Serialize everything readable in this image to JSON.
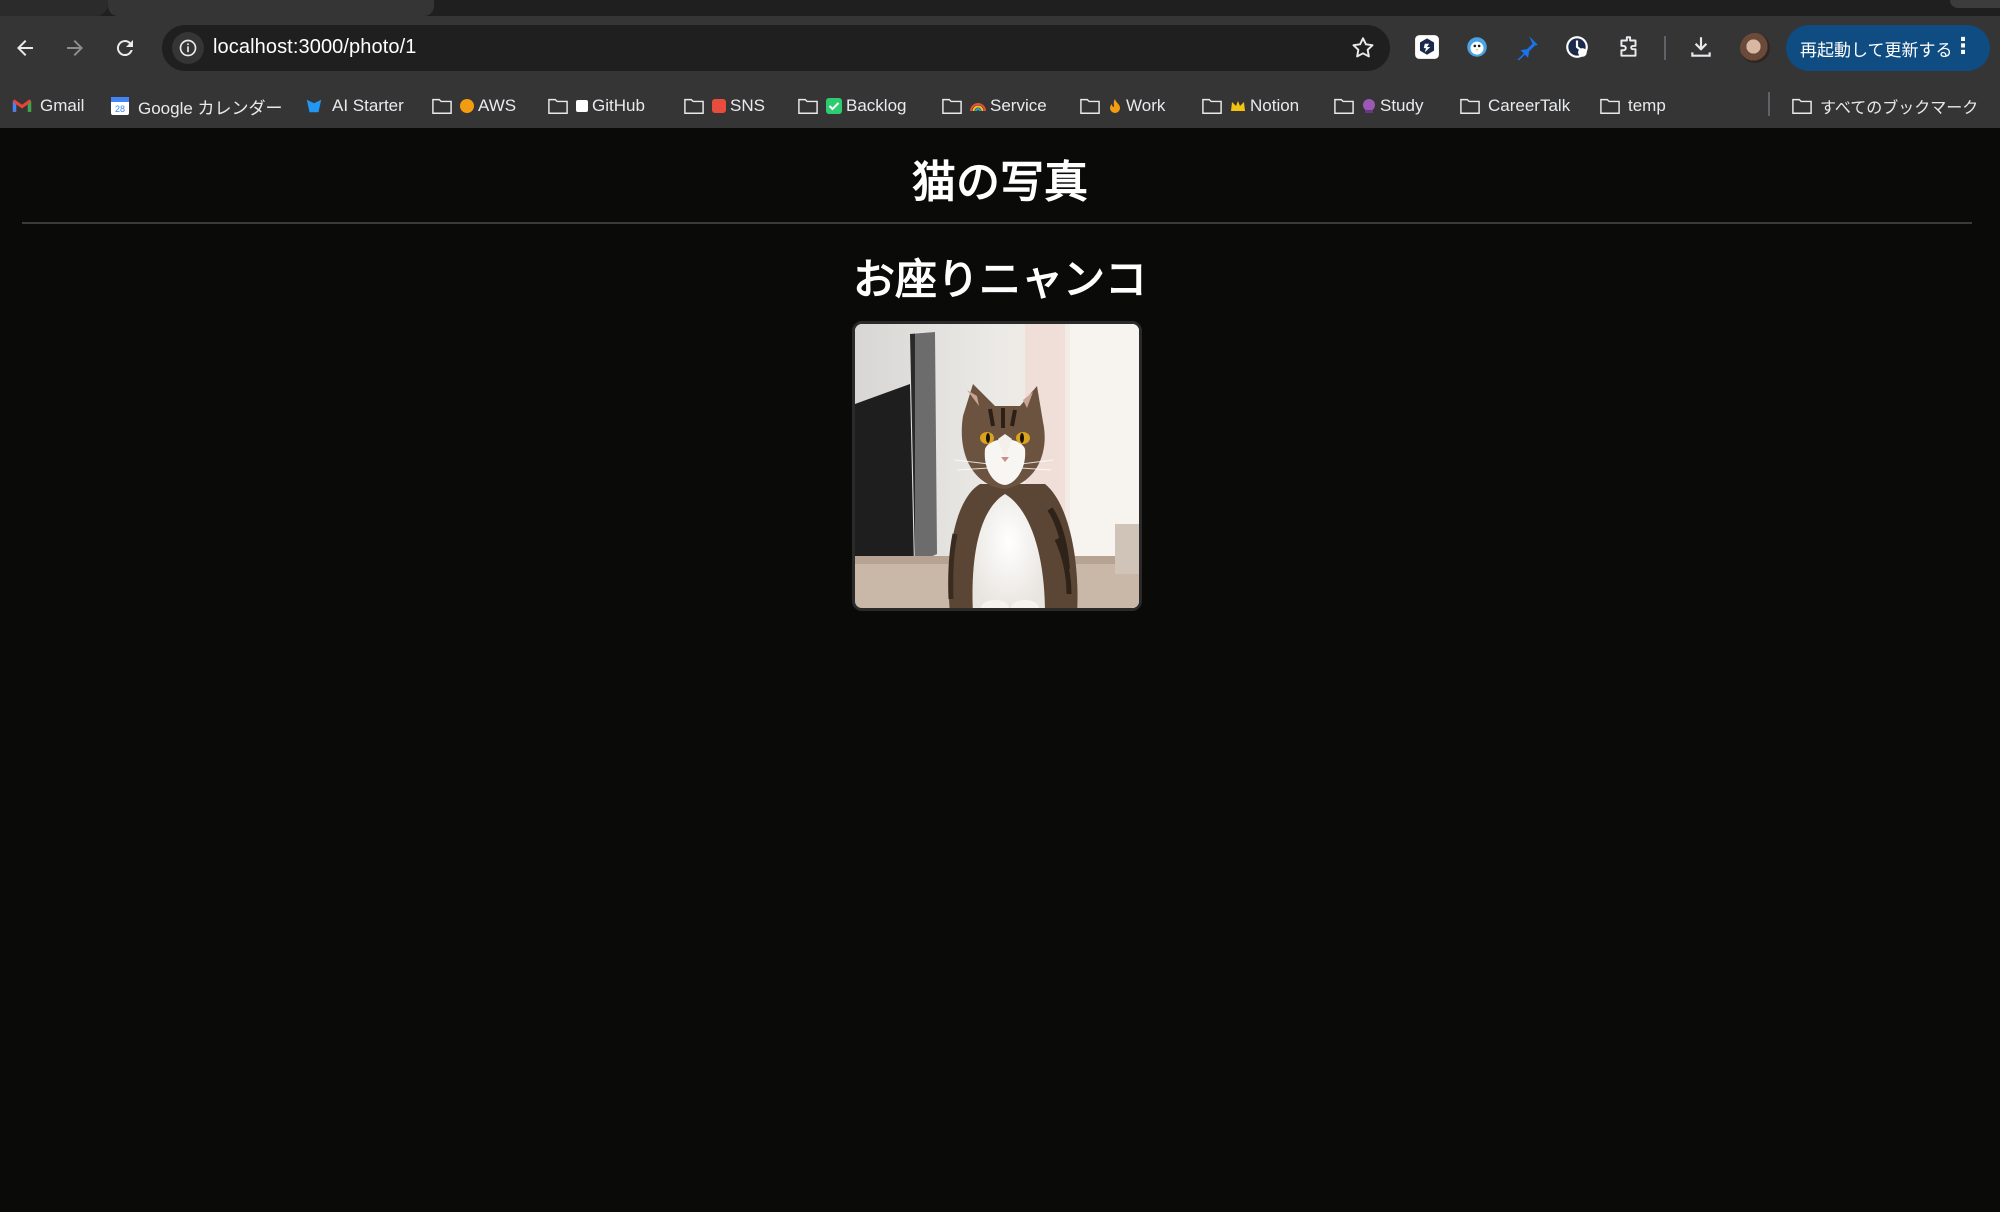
{
  "browser": {
    "url": "localhost:3000/photo/1",
    "update_button": "再起動して更新する"
  },
  "bookmarks": {
    "items": [
      {
        "label": "Gmail",
        "icon": "gmail-icon"
      },
      {
        "label": "Google カレンダー",
        "icon": "calendar-icon"
      },
      {
        "label": "AI Starter",
        "icon": "ai-starter-icon"
      },
      {
        "label": "AWS",
        "icon": "folder-icon"
      },
      {
        "label": "GitHub",
        "icon": "folder-icon"
      },
      {
        "label": "SNS",
        "icon": "folder-icon"
      },
      {
        "label": "Backlog",
        "icon": "folder-icon"
      },
      {
        "label": "Service",
        "icon": "folder-icon"
      },
      {
        "label": "Work",
        "icon": "folder-icon"
      },
      {
        "label": "Notion",
        "icon": "folder-icon"
      },
      {
        "label": "Study",
        "icon": "folder-icon"
      },
      {
        "label": "CareerTalk",
        "icon": "folder-icon"
      },
      {
        "label": "temp",
        "icon": "folder-icon"
      }
    ],
    "all_bookmarks": "すべてのブックマーク"
  },
  "page": {
    "title": "猫の写真",
    "photo_title": "お座りニャンコ"
  },
  "colors": {
    "page_background": "#0a0a09",
    "chrome_background": "#353535",
    "update_button": "#0f4c81"
  }
}
